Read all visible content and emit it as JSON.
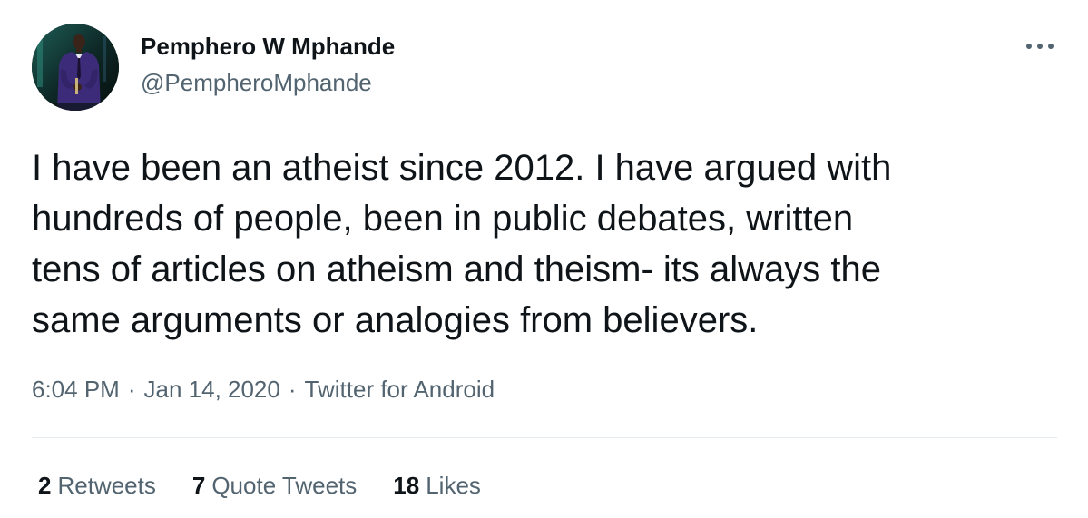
{
  "tweet": {
    "author": {
      "name": "Pemphero W Mphande",
      "handle": "@PempheroMphande"
    },
    "text_lines": [
      "I have been an atheist since 2012. I have argued with",
      "hundreds of people, been in public debates, written",
      "tens of articles on atheism and theism- its always the",
      "same arguments or analogies from believers."
    ],
    "time": "6:04 PM",
    "separator": "·",
    "date": "Jan 14, 2020",
    "source": "Twitter for Android",
    "stats": {
      "retweets": {
        "count": "2",
        "label": "Retweets"
      },
      "quote_tweets": {
        "count": "7",
        "label": "Quote Tweets"
      },
      "likes": {
        "count": "18",
        "label": "Likes"
      }
    },
    "more_icon": "more-horizontal-icon",
    "colors": {
      "text_primary": "#0f1419",
      "text_secondary": "#536471",
      "divider": "#e6ecf0"
    }
  }
}
